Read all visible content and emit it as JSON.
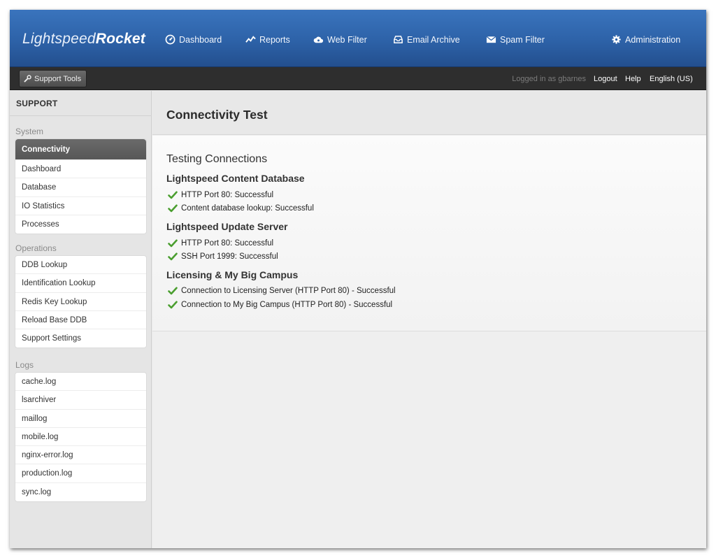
{
  "brand": {
    "logo_light": "Lightspeed",
    "logo_bold": "Rocket"
  },
  "nav": [
    {
      "label": "Dashboard",
      "icon": "dashboard-icon"
    },
    {
      "label": "Reports",
      "icon": "reports-icon"
    },
    {
      "label": "Web Filter",
      "icon": "cloud-icon"
    },
    {
      "label": "Email Archive",
      "icon": "inbox-icon"
    },
    {
      "label": "Spam Filter",
      "icon": "envelope-icon"
    },
    {
      "label": "Administration",
      "icon": "gear-icon"
    }
  ],
  "subbar": {
    "support_tools": "Support Tools",
    "logged_in": "Logged in as gbarnes",
    "logout": "Logout",
    "help": "Help",
    "language": "English (US)"
  },
  "sidebar": {
    "title": "SUPPORT",
    "sections": [
      {
        "name": "System",
        "items": [
          "Connectivity",
          "Dashboard",
          "Database",
          "IO Statistics",
          "Processes"
        ],
        "active": "Connectivity"
      },
      {
        "name": "Operations",
        "items": [
          "DDB Lookup",
          "Identification Lookup",
          "Redis Key Lookup",
          "Reload Base DDB",
          "Support Settings"
        ]
      },
      {
        "name": "Logs",
        "items": [
          "cache.log",
          "lsarchiver",
          "maillog",
          "mobile.log",
          "nginx-error.log",
          "production.log",
          "sync.log"
        ]
      }
    ]
  },
  "page": {
    "title": "Connectivity Test",
    "subtitle": "Testing Connections",
    "groups": [
      {
        "title": "Lightspeed Content Database",
        "results": [
          "HTTP Port 80: Successful",
          "Content database lookup: Successful"
        ]
      },
      {
        "title": "Lightspeed Update Server",
        "results": [
          "HTTP Port 80: Successful",
          "SSH Port 1999: Successful"
        ]
      },
      {
        "title": "Licensing & My Big Campus",
        "results": [
          "Connection to Licensing Server (HTTP Port 80) - Successful",
          "Connection to My Big Campus (HTTP Port 80) - Successful"
        ]
      }
    ]
  },
  "colors": {
    "nav_blue": "#2d62a8",
    "success_green": "#4a9e2f",
    "active_item": "#5f5f5f"
  }
}
